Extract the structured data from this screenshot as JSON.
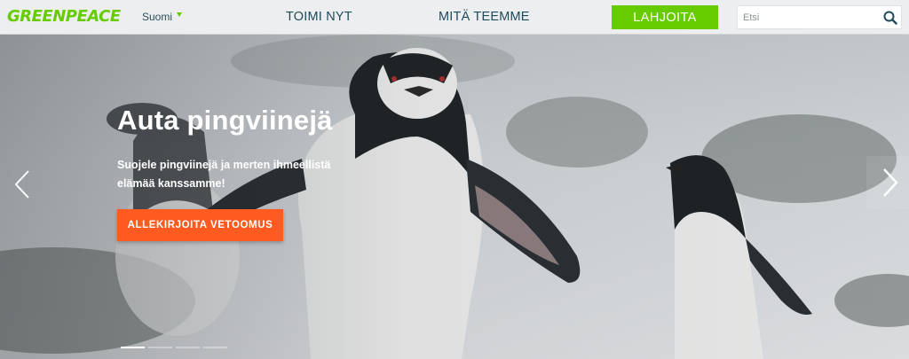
{
  "header": {
    "logo": "GREENPEACE",
    "language": "Suomi",
    "nav": [
      {
        "label": "TOIMI NYT"
      },
      {
        "label": "MITÄ TEEMME"
      }
    ],
    "donate_label": "LAHJOITA",
    "search_placeholder": "Etsi"
  },
  "hero": {
    "title": "Auta pingviinejä",
    "text": "Suojele pingviinejä ja merten ihmeellistä elämää kanssamme!",
    "cta_label": "ALLEKIRJOITA VETOOMUS",
    "slides": 4,
    "active_slide": 1
  },
  "colors": {
    "brand_green": "#66cc00",
    "cta_orange": "#ff5a1f",
    "nav_text": "#1e4a5c"
  },
  "icons": [
    "search-icon",
    "chevron-left-icon",
    "chevron-right-icon",
    "chevron-down-icon"
  ]
}
